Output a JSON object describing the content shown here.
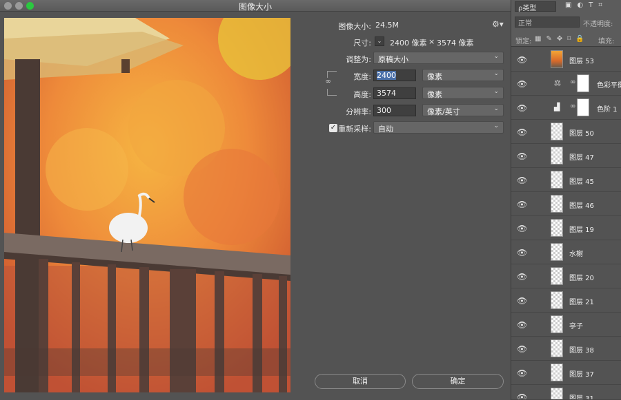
{
  "window": {
    "title": "图像大小"
  },
  "dialog": {
    "image_size_label": "图像大小:",
    "image_size_value": "24.5M",
    "dimensions_label": "尺寸:",
    "dimensions_value": "2400 像素",
    "dimensions_x": "×",
    "dimensions_value2": "3574 像素",
    "fit_to_label": "调整为:",
    "fit_to_value": "原稿大小",
    "width_label": "宽度:",
    "width_value": "2400",
    "width_unit": "像素",
    "height_label": "高度:",
    "height_value": "3574",
    "height_unit": "像素",
    "resolution_label": "分辨率:",
    "resolution_value": "300",
    "resolution_unit": "像素/英寸",
    "resample_label": "重新采样:",
    "resample_value": "自动",
    "cancel_label": "取消",
    "ok_label": "确定"
  },
  "layers_panel": {
    "filter_label": "ρ类型",
    "blend_mode": "正常",
    "opacity_label": "不透明度:",
    "lock_label": "锁定:",
    "fill_label": "填充:",
    "layers": [
      {
        "name": "图层 53",
        "thumb": "art"
      },
      {
        "name": "色彩平衡",
        "thumb": "adjust-balance"
      },
      {
        "name": "色阶 1",
        "thumb": "adjust-levels"
      },
      {
        "name": "图层 50",
        "thumb": "transparent"
      },
      {
        "name": "图层 47",
        "thumb": "transparent"
      },
      {
        "name": "图层 45",
        "thumb": "transparent"
      },
      {
        "name": "图层 46",
        "thumb": "transparent"
      },
      {
        "name": "图层 19",
        "thumb": "transparent"
      },
      {
        "name": "水榭",
        "thumb": "transparent"
      },
      {
        "name": "图层 20",
        "thumb": "transparent"
      },
      {
        "name": "图层 21",
        "thumb": "transparent"
      },
      {
        "name": "亭子",
        "thumb": "transparent"
      },
      {
        "name": "图层 38",
        "thumb": "transparent"
      },
      {
        "name": "图层 37",
        "thumb": "transparent"
      },
      {
        "name": "图层 31",
        "thumb": "transparent"
      }
    ]
  },
  "colors": {
    "dialog_bg": "#535353",
    "maximize": "#2bc840",
    "selection": "#4a6fa8"
  }
}
